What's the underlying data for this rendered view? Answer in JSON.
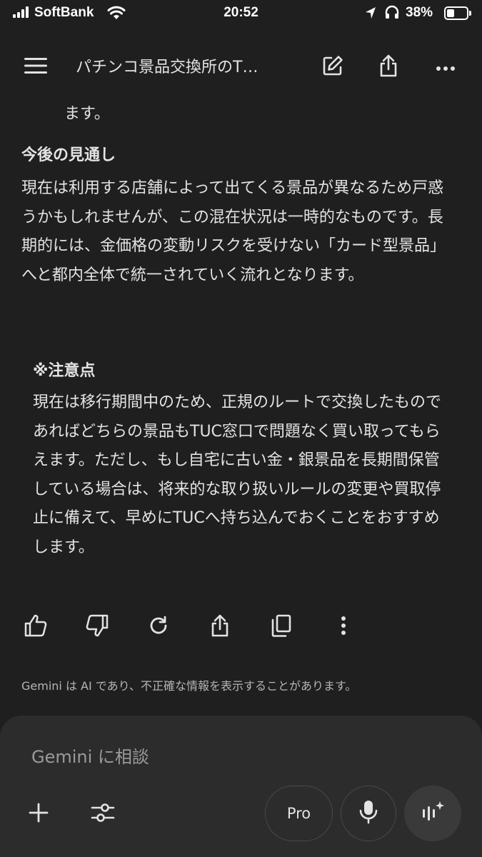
{
  "status_bar": {
    "carrier": "SoftBank",
    "time": "20:52",
    "battery_percent": "38%",
    "battery_level": 0.38,
    "signal_bars": 4
  },
  "app_bar": {
    "title": "パチンコ景品交換所のT…",
    "icons": [
      "menu-icon",
      "edit-icon",
      "share-icon",
      "more-vert-icon"
    ]
  },
  "message": {
    "tail_text": "ます。",
    "section_heading": "今後の見通し",
    "paragraph": "現在は利用する店舗によって出てくる景品が異なるため戸惑うかもしれませんが、この混在状況は一時的なものです。長期的には、金価格の変動リスクを受けない「カード型景品」へと都内全体で統一されていく流れとなります。",
    "note_heading": "※注意点",
    "note_text": "現在は移行期間中のため、正規のルートで交換したものであればどちらの景品もTUC窓口で問題なく買い取ってもらえます。ただし、もし自宅に古い金・銀景品を長期間保管している場合は、将来的な取り扱いルールの変更や買取停止に備えて、早めにTUCへ持ち込んでおくことをおすすめします。"
  },
  "actions": [
    "thumb-up-icon",
    "thumb-down-icon",
    "regenerate-icon",
    "share-icon",
    "copy-icon",
    "more-vert-icon"
  ],
  "disclaimer": "Gemini は AI であり、不正確な情報を表示することがあります。",
  "composer": {
    "placeholder": "Gemini に相談",
    "value": "",
    "model_label": "Pro"
  },
  "colors": {
    "background": "#1f1f1f",
    "composer": "#2c2c2c",
    "text": "#e3e3e3",
    "muted": "#b5b5b5"
  }
}
